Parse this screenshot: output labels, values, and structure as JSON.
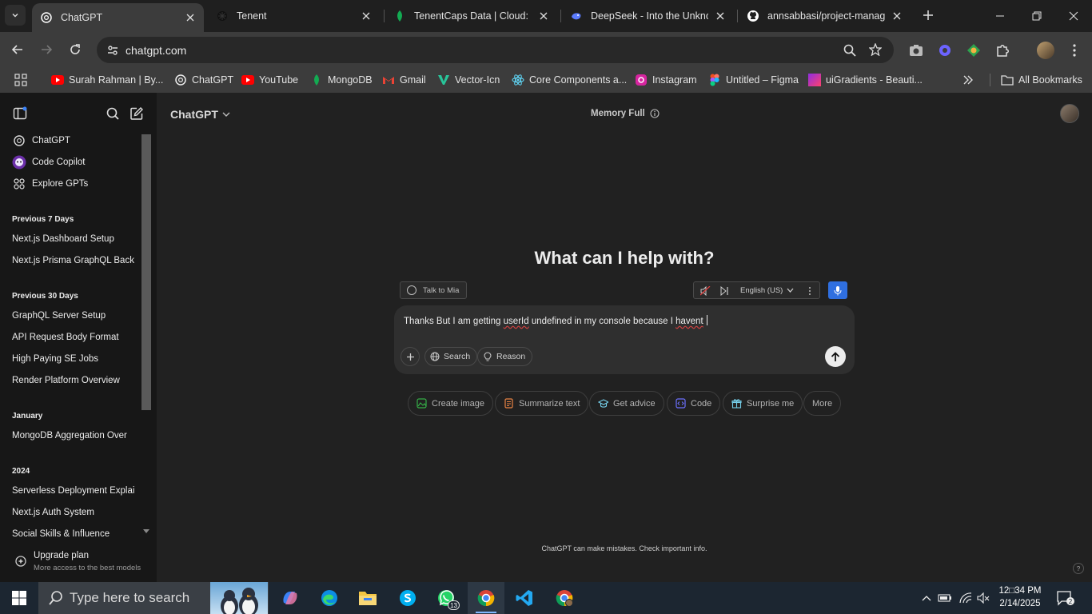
{
  "browser": {
    "tabs": [
      {
        "title": "ChatGPT",
        "active": true,
        "icon": "openai-icon"
      },
      {
        "title": "Tenent",
        "active": false,
        "icon": "dark-favicon-icon"
      },
      {
        "title": "TenentCaps Data | Cloud: Mo",
        "active": false,
        "icon": "mongodb-leaf-icon"
      },
      {
        "title": "DeepSeek - Into the Unknow",
        "active": false,
        "icon": "deepseek-whale-icon"
      },
      {
        "title": "annsabbasi/project-managm",
        "active": false,
        "icon": "github-icon"
      }
    ],
    "url": "chatgpt.com",
    "bookmarks": [
      {
        "label": "Surah Rahman | By...",
        "icon": "youtube-icon"
      },
      {
        "label": "ChatGPT",
        "icon": "openai-icon"
      },
      {
        "label": "YouTube",
        "icon": "youtube-icon"
      },
      {
        "label": "MongoDB",
        "icon": "mongodb-leaf-icon"
      },
      {
        "label": "Gmail",
        "icon": "gmail-icon"
      },
      {
        "label": "Vector-Icn",
        "icon": "vector-icon"
      },
      {
        "label": "Core Components a...",
        "icon": "react-icon"
      },
      {
        "label": "Instagram",
        "icon": "instagram-icon"
      },
      {
        "label": "Untitled – Figma",
        "icon": "figma-icon"
      },
      {
        "label": "uiGradients - Beauti...",
        "icon": "gradient-icon"
      }
    ],
    "all_bookmarks": "All Bookmarks"
  },
  "sidebar": {
    "top_items": [
      {
        "label": "ChatGPT",
        "icon": "openai-icon"
      },
      {
        "label": "Code Copilot",
        "icon": "copilot-avatar-icon"
      },
      {
        "label": "Explore GPTs",
        "icon": "grid-icon"
      }
    ],
    "groups": [
      {
        "heading": "Previous 7 Days",
        "items": [
          "Next.js Dashboard Setup",
          "Next.js Prisma GraphQL Back"
        ]
      },
      {
        "heading": "Previous 30 Days",
        "items": [
          "GraphQL Server Setup",
          "API Request Body Format",
          "High Paying SE Jobs",
          "Render Platform Overview"
        ]
      },
      {
        "heading": "January",
        "items": [
          "MongoDB Aggregation Over"
        ]
      },
      {
        "heading": "2024",
        "items": [
          "Serverless Deployment Explai",
          "Next.js Auth System",
          "Social Skills & Influence"
        ]
      }
    ],
    "upgrade": {
      "title": "Upgrade plan",
      "subtitle": "More access to the best models"
    }
  },
  "main": {
    "model": "ChatGPT",
    "memory_status": "Memory Full",
    "hero": "What can I help with?",
    "talk_button": "Talk to Mia",
    "voice_language": "English (US)",
    "composer": {
      "text_before": "Thanks But I am getting ",
      "text_misspelled_1": "userId",
      "text_middle": " undefined in my console because I ",
      "text_misspelled_2": "havent",
      "search_label": "Search",
      "reason_label": "Reason"
    },
    "chips": [
      {
        "label": "Create image",
        "icon": "image-icon",
        "color": "#35ae47"
      },
      {
        "label": "Summarize text",
        "icon": "document-icon",
        "color": "#ea8444"
      },
      {
        "label": "Get advice",
        "icon": "graduation-cap-icon",
        "color": "#76d0eb"
      },
      {
        "label": "Code",
        "icon": "code-icon",
        "color": "#6c71ff"
      },
      {
        "label": "Surprise me",
        "icon": "gift-icon",
        "color": "#76d0eb"
      },
      {
        "label": "More",
        "icon": "",
        "color": ""
      }
    ],
    "disclaimer": "ChatGPT can make mistakes. Check important info.",
    "help": "?"
  },
  "taskbar": {
    "search_placeholder": "Type here to search",
    "whatsapp_badge": "13",
    "time": "12□34 PM",
    "date": "2/14/2025"
  },
  "colors": {
    "accent_blue": "#2f6fe0",
    "sidebar_bg": "#171717",
    "main_bg": "#212121",
    "composer_bg": "#2f2f2f"
  }
}
